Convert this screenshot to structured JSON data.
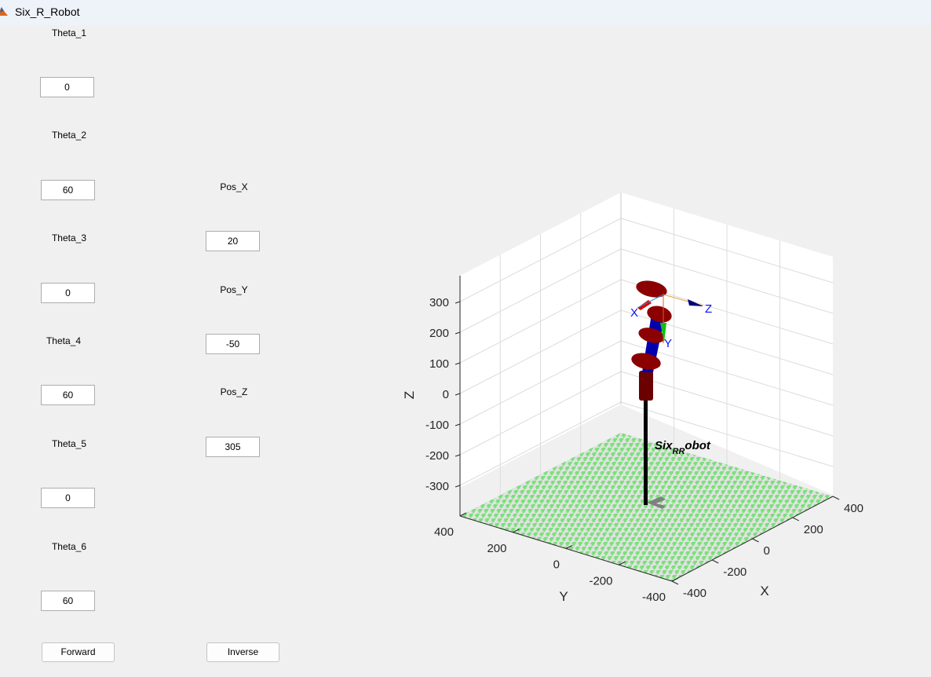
{
  "window": {
    "title": "Six_R_Robot",
    "icon": "matlab-icon"
  },
  "joints": [
    {
      "label": "Theta_1",
      "value": "0"
    },
    {
      "label": "Theta_2",
      "value": "60"
    },
    {
      "label": "Theta_3",
      "value": "0"
    },
    {
      "label": "Theta_4",
      "value": "60"
    },
    {
      "label": "Theta_5",
      "value": "0"
    },
    {
      "label": "Theta_6",
      "value": "60"
    }
  ],
  "positions": [
    {
      "label": "Pos_X",
      "value": "20"
    },
    {
      "label": "Pos_Y",
      "value": "-50"
    },
    {
      "label": "Pos_Z",
      "value": "305"
    }
  ],
  "buttons": {
    "forward": "Forward",
    "inverse": "Inverse"
  },
  "plot": {
    "robot_name_main": "Six",
    "robot_name_sub": "RR",
    "robot_name_tail": "obot",
    "frame_labels": {
      "x": "X",
      "y": "Y",
      "z": "Z"
    },
    "colors": {
      "link": "#8b0000",
      "joint_axis": "#0000b0",
      "floor_green": "#7be07b",
      "floor_gray": "#e0e0e0"
    }
  },
  "chart_data": {
    "type": "3d-plot",
    "xlabel": "X",
    "ylabel": "Y",
    "zlabel": "Z",
    "xlim": [
      -400,
      400
    ],
    "ylim": [
      -400,
      400
    ],
    "zlim": [
      -400,
      400
    ],
    "xticks": [
      "-400",
      "-200",
      "0",
      "200",
      "400"
    ],
    "yticks": [
      "400",
      "200",
      "0",
      "-200",
      "-400"
    ],
    "zticks": [
      "300",
      "200",
      "100",
      "0",
      "-100",
      "-200",
      "-300"
    ],
    "grid": true,
    "annotation": "Six_RRobot"
  }
}
